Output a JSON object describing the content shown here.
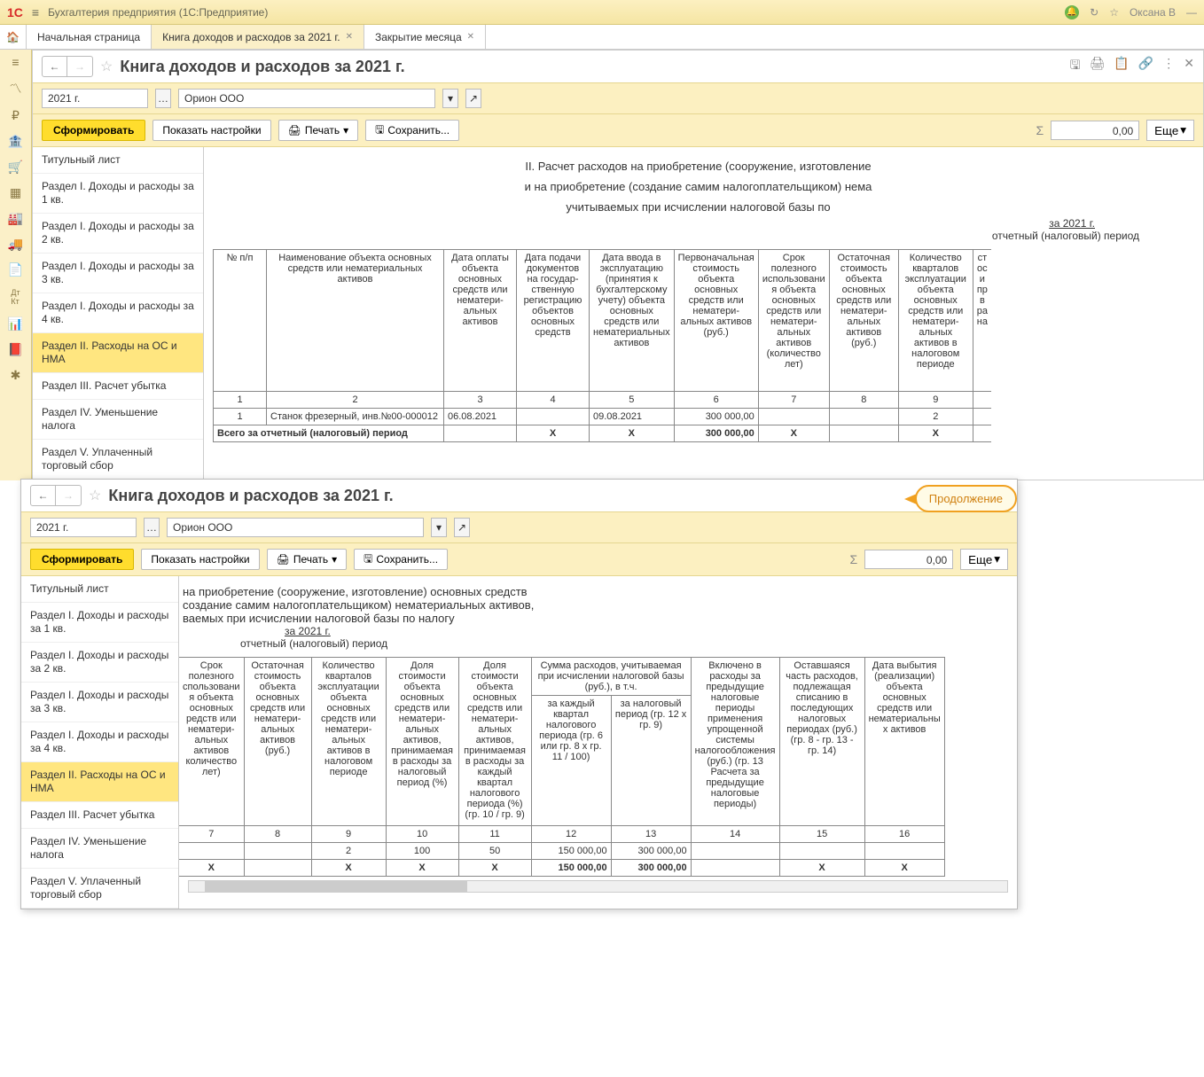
{
  "header": {
    "app_title": "Бухгалтерия предприятия  (1С:Предприятие)",
    "user_name": "Оксана В"
  },
  "tabs": {
    "start": "Начальная страница",
    "t1": "Книга доходов и расходов за 2021 г.",
    "t2": "Закрытие месяца"
  },
  "panel": {
    "title": "Книга доходов и расходов за 2021 г.",
    "year": "2021 г.",
    "org": "Орион ООО",
    "btn_form": "Сформировать",
    "btn_settings": "Показать настройки",
    "btn_print": "Печать",
    "btn_save": "Сохранить...",
    "sum": "0,00",
    "btn_more": "Еще"
  },
  "tree": [
    "Титульный лист",
    "Раздел I. Доходы и расходы за 1 кв.",
    "Раздел I. Доходы и расходы за 2 кв.",
    "Раздел I. Доходы и расходы за 3 кв.",
    "Раздел I. Доходы и расходы за 4 кв.",
    "Раздел II. Расходы на ОС и НМА",
    "Раздел III. Расчет убытка",
    "Раздел IV. Уменьшение налога",
    "Раздел V. Уплаченный торговый сбор"
  ],
  "doc1": {
    "title_l1": "II. Расчет расходов на приобретение (сооружение, изготовление",
    "title_l2": "и на приобретение (создание самим налогоплательщиком) нема",
    "title_l3": "учитываемых при исчислении налоговой базы по",
    "year_line": "за 2021 г.",
    "sub": "отчетный (налоговый) период",
    "cols_num": [
      "1",
      "2",
      "3",
      "4",
      "5",
      "6",
      "7",
      "8",
      "9",
      ""
    ],
    "head": [
      "№ п/п",
      "Наименование объекта основных средств или нематериальных активов",
      "Дата оплаты объекта основных средств или нематери-альных активов",
      "Дата подачи документов на государ-ственную регистрацию объектов основных средств",
      "Дата ввода в эксплуатацию (принятия к бухгалтерскому учету) объекта основных средств или нематериальных активов",
      "Первоначальная стоимость объекта основных средств или нематери-альных активов (руб.)",
      "Срок полезного использовани я объекта основных средств или нематери-альных активов (количество лет)",
      "Остаточная стоимость объекта основных средств или нематери-альных активов (руб.)",
      "Количество кварталов эксплуатации объекта основных средств или нематери-альных активов в налоговом периоде",
      "ст ос и пр в ра на"
    ],
    "row1": [
      "1",
      "Станок фрезерный, инв.№00-000012",
      "06.08.2021",
      "",
      "09.08.2021",
      "300 000,00",
      "",
      "",
      "2",
      ""
    ],
    "total_label": "Всего за отчетный (налоговый) период",
    "total_row": [
      "",
      "",
      "",
      "X",
      "X",
      "300 000,00",
      "X",
      "",
      "X",
      ""
    ]
  },
  "continue_label": "Продолжение",
  "doc2": {
    "title_l1": "на приобретение (сооружение, изготовление) основных средств",
    "title_l2": "создание самим налогоплательщиком) нематериальных активов,",
    "title_l3": "ваемых при исчислении налоговой базы по налогу",
    "year_line": "за 2021 г.",
    "sub": "отчетный (налоговый) период",
    "head_group_top": "Сумма расходов, учитываемая при исчислении налоговой базы (руб.), в т.ч.",
    "head": [
      "Срок полезного спользовани я объекта основных редств или нематери-альных активов количество лет)",
      "Остаточная стоимость объекта основных средств или нематери-альных активов (руб.)",
      "Количество кварталов эксплуатации объекта основных средств или нематери-альных активов в налоговом периоде",
      "Доля стоимости объекта основных средств или нематери-альных активов, принимаемая в расходы за налоговый период (%)",
      "Доля стоимости объекта основных средств или нематери-альных активов, принимаемая в расходы за каждый квартал налогового периода (%) (гр. 10 / гр. 9)",
      "за каждый квартал налогового периода (гр. 6 или гр. 8 x гр. 11 / 100)",
      "за налоговый период (гр. 12 x гр. 9)",
      "Включено в расходы за предыдущие налоговые периоды применения упрощенной системы налогообложения (руб.) (гр. 13 Расчета за предыдущие налоговые периоды)",
      "Оставшаяся часть расходов, подлежащая списанию в последующих налоговых периодах (руб.) (гр. 8 - гр. 13 - гр. 14)",
      "Дата выбытия (реализации) объекта основных средств или нематериальны х активов"
    ],
    "cols_num": [
      "7",
      "8",
      "9",
      "10",
      "11",
      "12",
      "13",
      "14",
      "15",
      "16"
    ],
    "row1": [
      "",
      "",
      "2",
      "100",
      "50",
      "150 000,00",
      "300 000,00",
      "",
      "",
      ""
    ],
    "total_row": [
      "X",
      "",
      "X",
      "X",
      "X",
      "150 000,00",
      "300 000,00",
      "",
      "X",
      "X"
    ]
  }
}
